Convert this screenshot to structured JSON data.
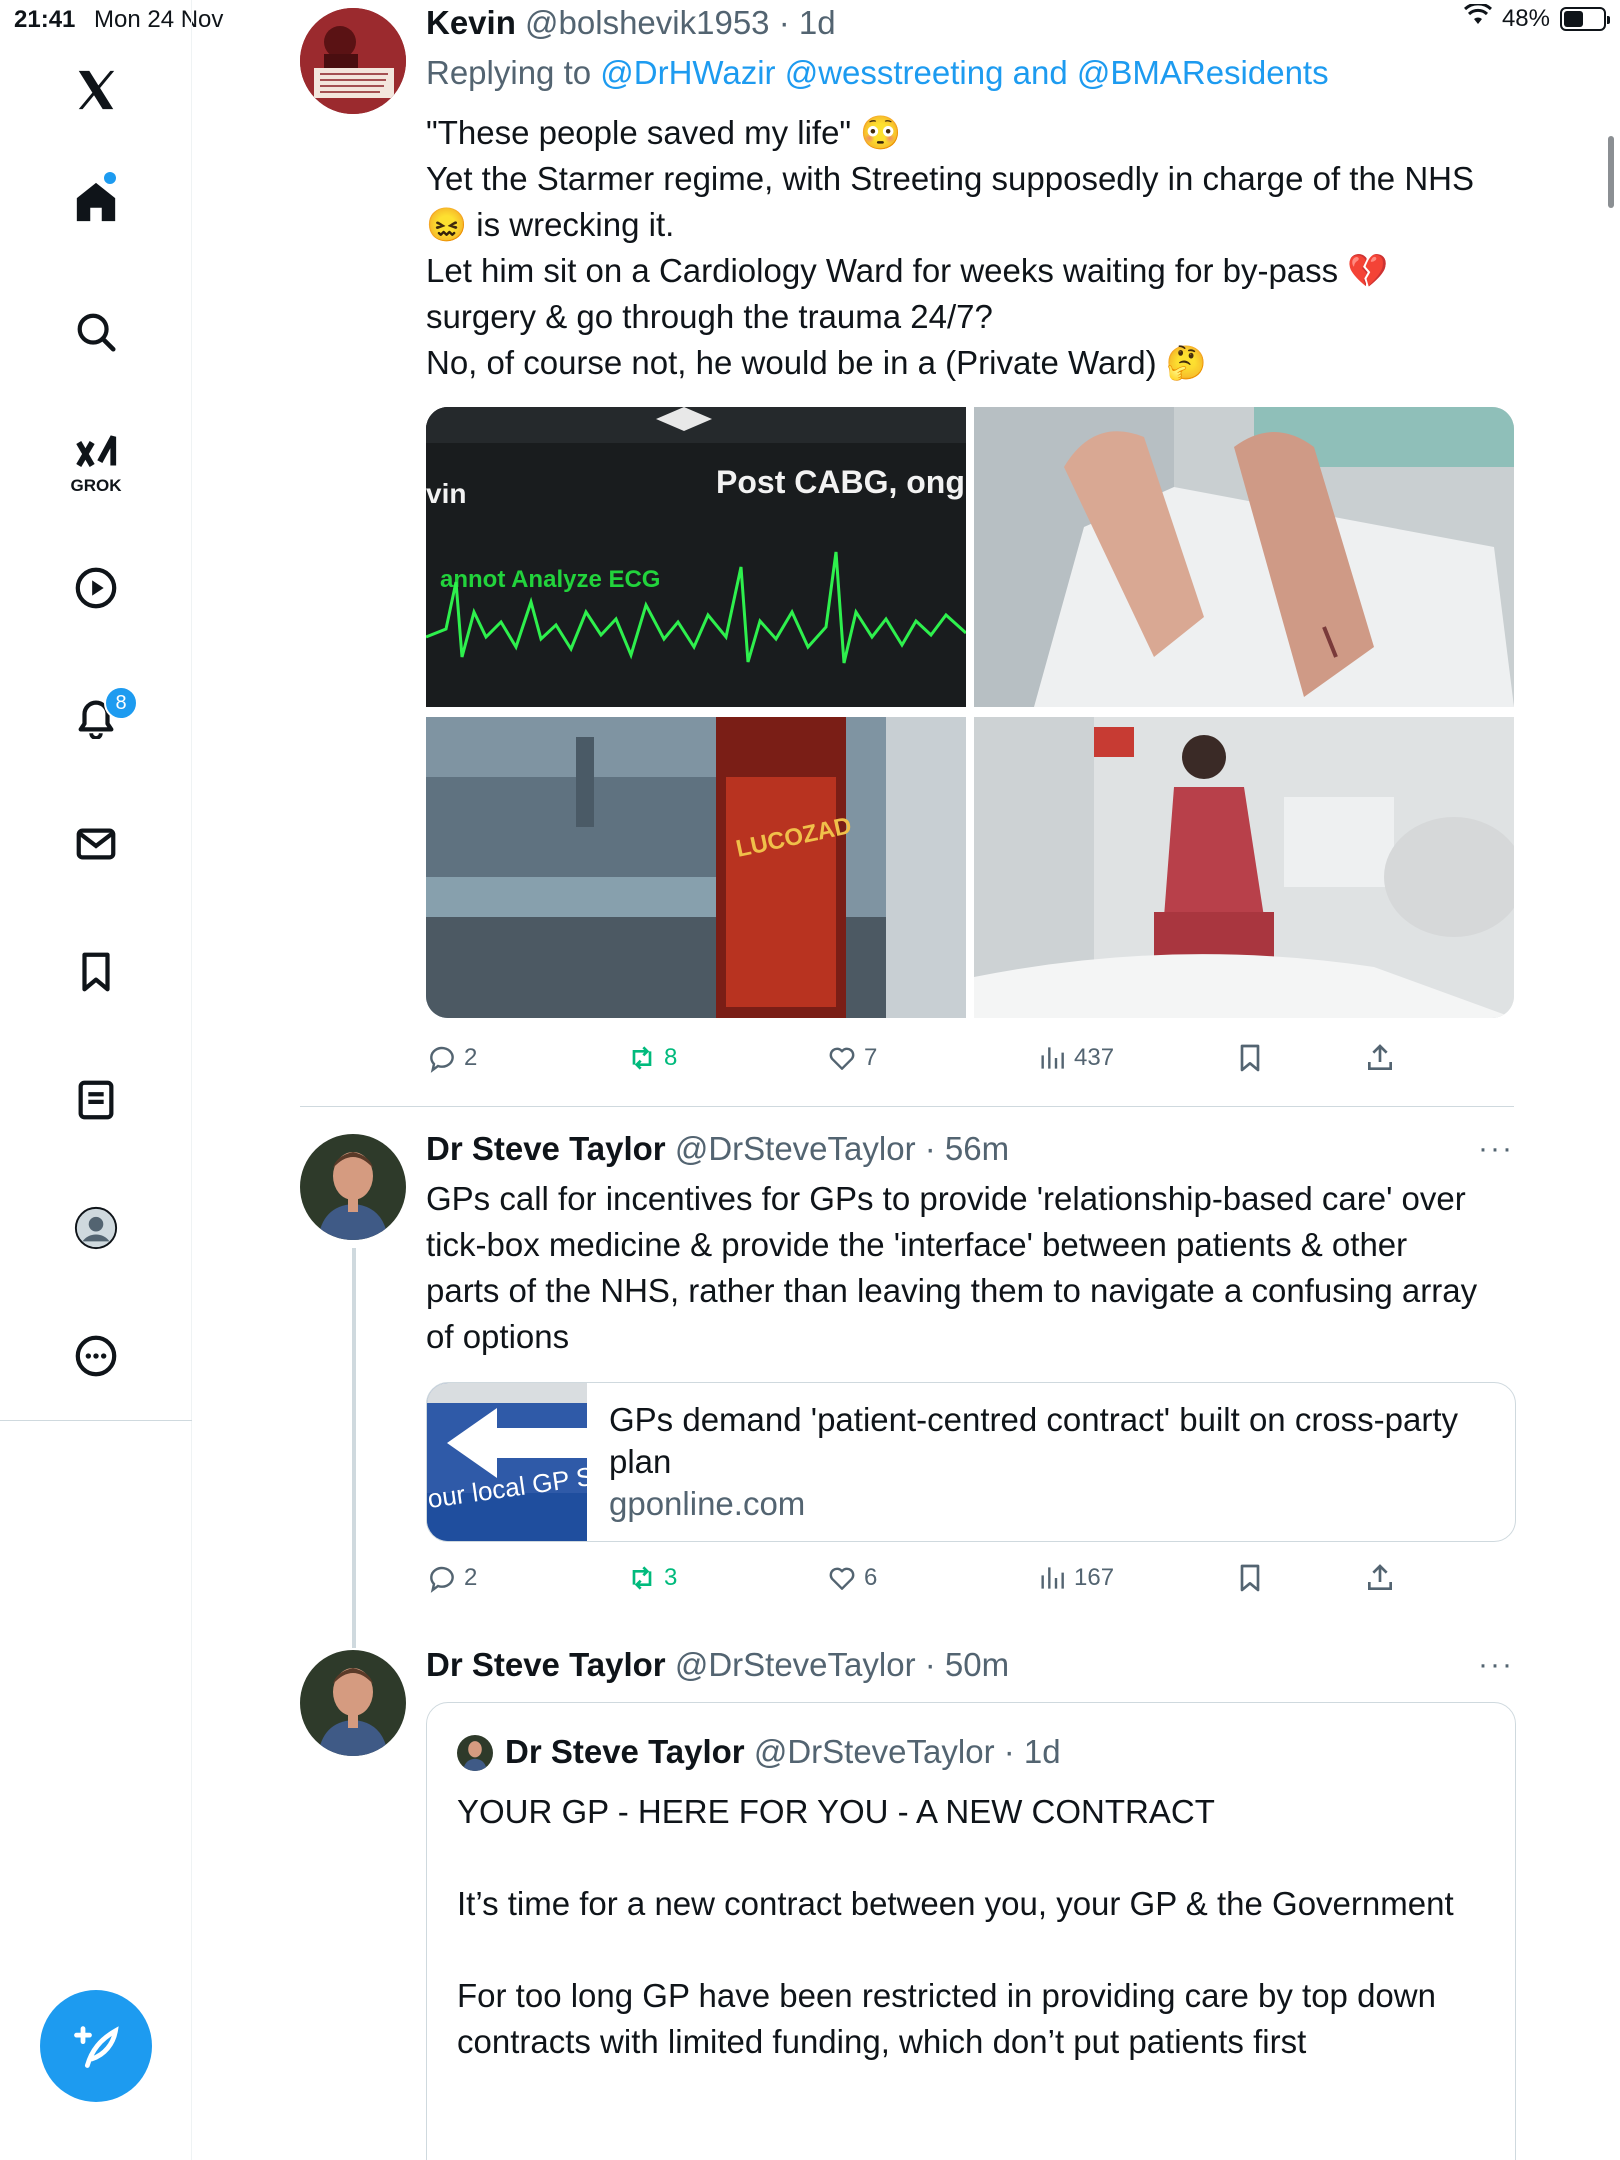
{
  "status_bar": {
    "time": "21:41",
    "date": "Mon 24 Nov",
    "battery": "48%",
    "battery_level": 0.48
  },
  "sidebar": {
    "items": [
      "x-logo",
      "home",
      "search",
      "grok",
      "video",
      "notifications",
      "messages",
      "bookmarks",
      "lists",
      "profile",
      "more"
    ],
    "grok_label": "GROK",
    "notifications_badge": "8"
  },
  "posts": [
    {
      "name": "Kevin",
      "handle": "@bolshevik1953",
      "time": "1d",
      "replying_label": "Replying to",
      "replying_to": "@DrHWazir @wesstreeting and @BMAResidents",
      "text": [
        "\"These people saved my life\" 😳",
        "Yet the Starmer regime, with Streeting supposedly in charge of the NHS",
        "😖 is wrecking it.",
        "Let him sit on a Cardiology Ward for weeks waiting for by-pass 💔",
        "surgery & go through the trauma 24/7?",
        "No, of course not, he would be in a (Private Ward) 🤔"
      ],
      "media": {
        "ecg_label_top": "Post CABG, ongo",
        "ecg_label_left": "vin",
        "ecg_label_warning": "annot Analyze ECG",
        "bottle_label": "LUCOZAD"
      },
      "stats": {
        "replies": "2",
        "reposts": "8",
        "likes": "7",
        "views": "437"
      }
    },
    {
      "name": "Dr Steve Taylor",
      "handle": "@DrSteveTaylor",
      "time": "56m",
      "text": [
        "GPs call for incentives for GPs to provide 'relationship-based care' over",
        "tick-box medicine & provide the 'interface' between patients & other",
        "parts of the NHS, rather than leaving them to navigate a confusing array",
        "of options"
      ],
      "link_card": {
        "title": "GPs demand 'patient-centred contract' built on cross-party plan",
        "domain": "gponline.com",
        "thumb_text": "our local GP S"
      },
      "stats": {
        "replies": "2",
        "reposts": "3",
        "likes": "6",
        "views": "167"
      }
    },
    {
      "name": "Dr Steve Taylor",
      "handle": "@DrSteveTaylor",
      "time": "50m",
      "quote": {
        "name": "Dr Steve Taylor",
        "handle": "@DrSteveTaylor",
        "time": "1d",
        "paragraphs": [
          "YOUR GP - HERE FOR YOU - A NEW CONTRACT",
          "It’s time for a new contract between you, your GP & the Government",
          "For too long GP have been restricted in providing care by top down contracts with limited funding, which don’t put patients first"
        ]
      }
    }
  ],
  "colors": {
    "accent": "#1d9bf0",
    "repost": "#00ba7c",
    "secondary_text": "#536471",
    "border": "#cfd9de"
  }
}
